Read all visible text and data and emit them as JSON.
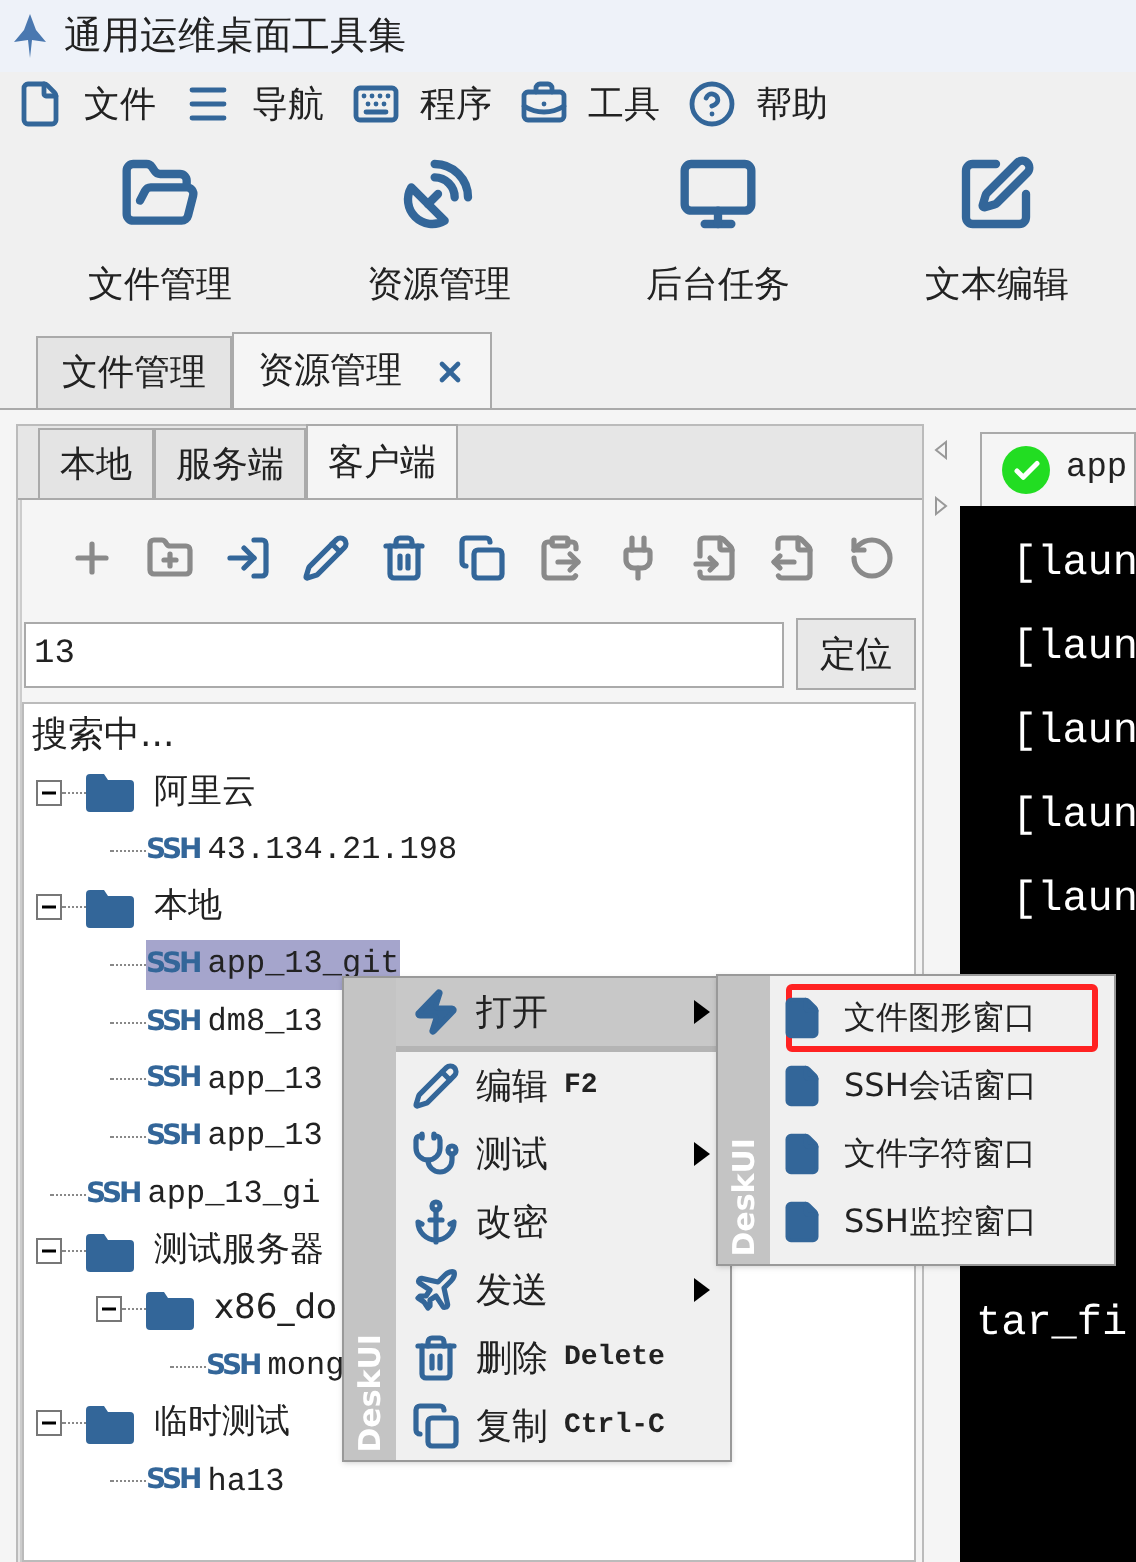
{
  "window": {
    "title": "通用运维桌面工具集"
  },
  "menu_bar": [
    {
      "label": "文件"
    },
    {
      "label": "导航"
    },
    {
      "label": "程序"
    },
    {
      "label": "工具"
    },
    {
      "label": "帮助"
    }
  ],
  "toolbar": [
    {
      "label": "文件管理"
    },
    {
      "label": "资源管理"
    },
    {
      "label": "后台任务"
    },
    {
      "label": "文本编辑"
    }
  ],
  "document_tabs": [
    {
      "label": "文件管理",
      "selected": false,
      "closable": false
    },
    {
      "label": "资源管理",
      "selected": true,
      "closable": true
    }
  ],
  "resource_tabs": [
    {
      "label": "本地",
      "selected": false
    },
    {
      "label": "服务端",
      "selected": false
    },
    {
      "label": "客户端",
      "selected": true
    }
  ],
  "tree_toolbar": [
    {
      "enabled": false
    },
    {
      "enabled": false
    },
    {
      "enabled": true
    },
    {
      "enabled": true
    },
    {
      "enabled": true
    },
    {
      "enabled": true
    },
    {
      "enabled": false
    },
    {
      "enabled": false
    },
    {
      "enabled": false
    },
    {
      "enabled": false
    },
    {
      "enabled": false
    }
  ],
  "search": {
    "value": "13",
    "button": "定位"
  },
  "tree": {
    "status": "搜索中...",
    "nodes": [
      {
        "kind": "folder",
        "label": "阿里云",
        "expanded": true,
        "selected": false,
        "children": [
          {
            "kind": "ssh",
            "badge": "SSH",
            "label": "43.134.21.198",
            "selected": false
          }
        ]
      },
      {
        "kind": "folder",
        "label": "本地",
        "expanded": true,
        "selected": false,
        "children": [
          {
            "kind": "ssh",
            "badge": "SSH",
            "label": "app_13_git",
            "selected": true
          },
          {
            "kind": "ssh",
            "badge": "SSH",
            "label": "dm8_13",
            "selected": false
          },
          {
            "kind": "ssh",
            "badge": "SSH",
            "label": "app_13",
            "selected": false
          },
          {
            "kind": "ssh",
            "badge": "SSH",
            "label": "app_13",
            "selected": false
          }
        ]
      },
      {
        "kind": "ssh",
        "badge": "SSH",
        "label": "app_13_gi",
        "selected": false
      },
      {
        "kind": "folder",
        "label": "测试服务器",
        "expanded": true,
        "selected": false,
        "children": [
          {
            "kind": "folder",
            "label": "x86_do",
            "expanded": true,
            "selected": false,
            "children": [
              {
                "kind": "ssh",
                "badge": "SSH",
                "label": "mong",
                "selected": false
              }
            ]
          }
        ]
      },
      {
        "kind": "folder",
        "label": "临时测试",
        "expanded": true,
        "selected": false,
        "children": [
          {
            "kind": "ssh",
            "badge": "SSH",
            "label": "ha13",
            "selected": false
          }
        ]
      }
    ]
  },
  "context_menu": {
    "brand": "DeskUI",
    "items": [
      {
        "label": "打开",
        "selected": true,
        "has_submenu": true,
        "separator_after": true
      },
      {
        "label": "编辑",
        "shortcut": "F2",
        "selected": false,
        "has_submenu": false,
        "separator_after": false
      },
      {
        "label": "测试",
        "selected": false,
        "has_submenu": true,
        "separator_after": false
      },
      {
        "label": "改密",
        "selected": false,
        "has_submenu": false,
        "separator_after": false
      },
      {
        "label": "发送",
        "selected": false,
        "has_submenu": true,
        "separator_after": false
      },
      {
        "label": "删除",
        "shortcut": "Delete",
        "selected": false,
        "has_submenu": false,
        "separator_after": false
      },
      {
        "label": "复制",
        "shortcut": "Ctrl-C",
        "selected": false,
        "has_submenu": false,
        "separator_after": false
      }
    ]
  },
  "submenu": {
    "brand": "DeskUI",
    "items": [
      {
        "label": "文件图形窗口",
        "annotated": true
      },
      {
        "label": "SSH会话窗口",
        "annotated": false
      },
      {
        "label": "文件字符窗口",
        "annotated": false
      },
      {
        "label": "SSH监控窗口",
        "annotated": false
      }
    ]
  },
  "terminal": {
    "tab": {
      "label": "app"
    },
    "lines": [
      {
        "text": "[laun",
        "spacer_before": false
      },
      {
        "text": "[laun",
        "spacer_before": false
      },
      {
        "text": "[laun",
        "spacer_before": false
      },
      {
        "text": "[laun",
        "spacer_before": false
      },
      {
        "text": "[laun",
        "spacer_before": false
      },
      {
        "text": "tar_fi",
        "spacer_before": true
      }
    ]
  }
}
